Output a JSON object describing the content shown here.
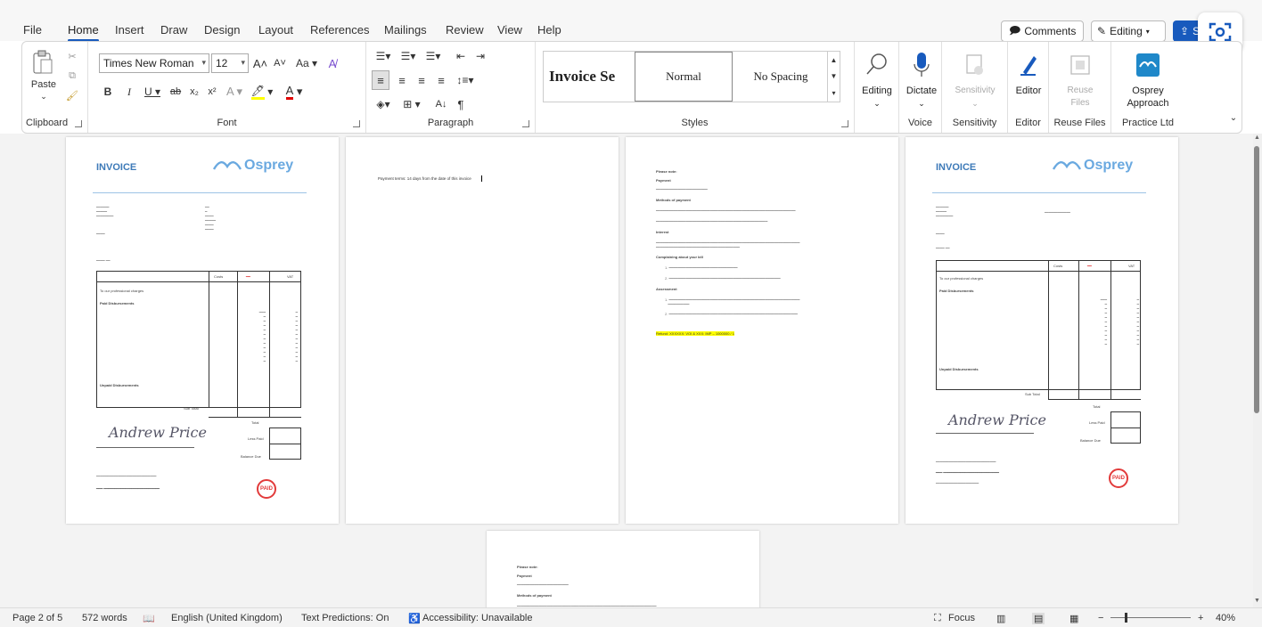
{
  "ribbon_tabs": [
    "File",
    "Home",
    "Insert",
    "Draw",
    "Design",
    "Layout",
    "References",
    "Mailings",
    "Review",
    "View",
    "Help"
  ],
  "active_tab": "Home",
  "top_right": {
    "comments": "Comments",
    "editing": "Editing",
    "share": "Share"
  },
  "clipboard": {
    "paste": "Paste",
    "label": "Clipboard"
  },
  "font": {
    "name": "Times New Roman",
    "size": "12",
    "label": "Font"
  },
  "paragraph": {
    "label": "Paragraph"
  },
  "styles": {
    "items": [
      "Invoice Se",
      "Normal",
      "No Spacing"
    ],
    "label": "Styles"
  },
  "editing_group": {
    "button": "Editing"
  },
  "voice": {
    "button": "Dictate",
    "label": "Voice"
  },
  "sensitivity": {
    "button": "Sensitivity",
    "label": "Sensitivity"
  },
  "editor": {
    "button": "Editor",
    "label": "Editor"
  },
  "reuse": {
    "button_line1": "Reuse",
    "button_line2": "Files",
    "label": "Reuse Files"
  },
  "osprey_addin": {
    "line1": "Osprey",
    "line2": "Approach",
    "label": "Practice Ltd"
  },
  "pages": {
    "invoice_title": "INVOICE",
    "brand": "Osprey",
    "page2_text": "Payment terms: 14 days from the date of this invoice",
    "page3_highlight": "Refund: XXXXXX: VOI & XXX: IMP – 1000000 / 1",
    "page3_headings": [
      "Please note:",
      "Payment",
      "Methods of payment",
      "Interest",
      "Complaining about your bill",
      "Assessment"
    ],
    "invoice_lines": {
      "professional": "To our professional charges",
      "paid": "Paid Disbursements",
      "unpaid": "Unpaid Disbursements",
      "subtotal": "Sub Total",
      "total": "Total",
      "less_paid": "Less Paid",
      "balance": "Balance Due"
    },
    "col_heads": [
      "Costs",
      "VAT"
    ],
    "paid_stamp": "PAID",
    "signature": "Andrew Price"
  },
  "status": {
    "page": "Page 2 of 5",
    "words": "572 words",
    "language": "English (United Kingdom)",
    "predictions": "Text Predictions: On",
    "accessibility": "Accessibility: Unavailable",
    "focus": "Focus",
    "zoom": "40%"
  },
  "colors": {
    "accent": "#185abd",
    "brand_blue": "#6aa9e0",
    "highlight": "#ffff00",
    "paid_red": "#e23b3b"
  }
}
